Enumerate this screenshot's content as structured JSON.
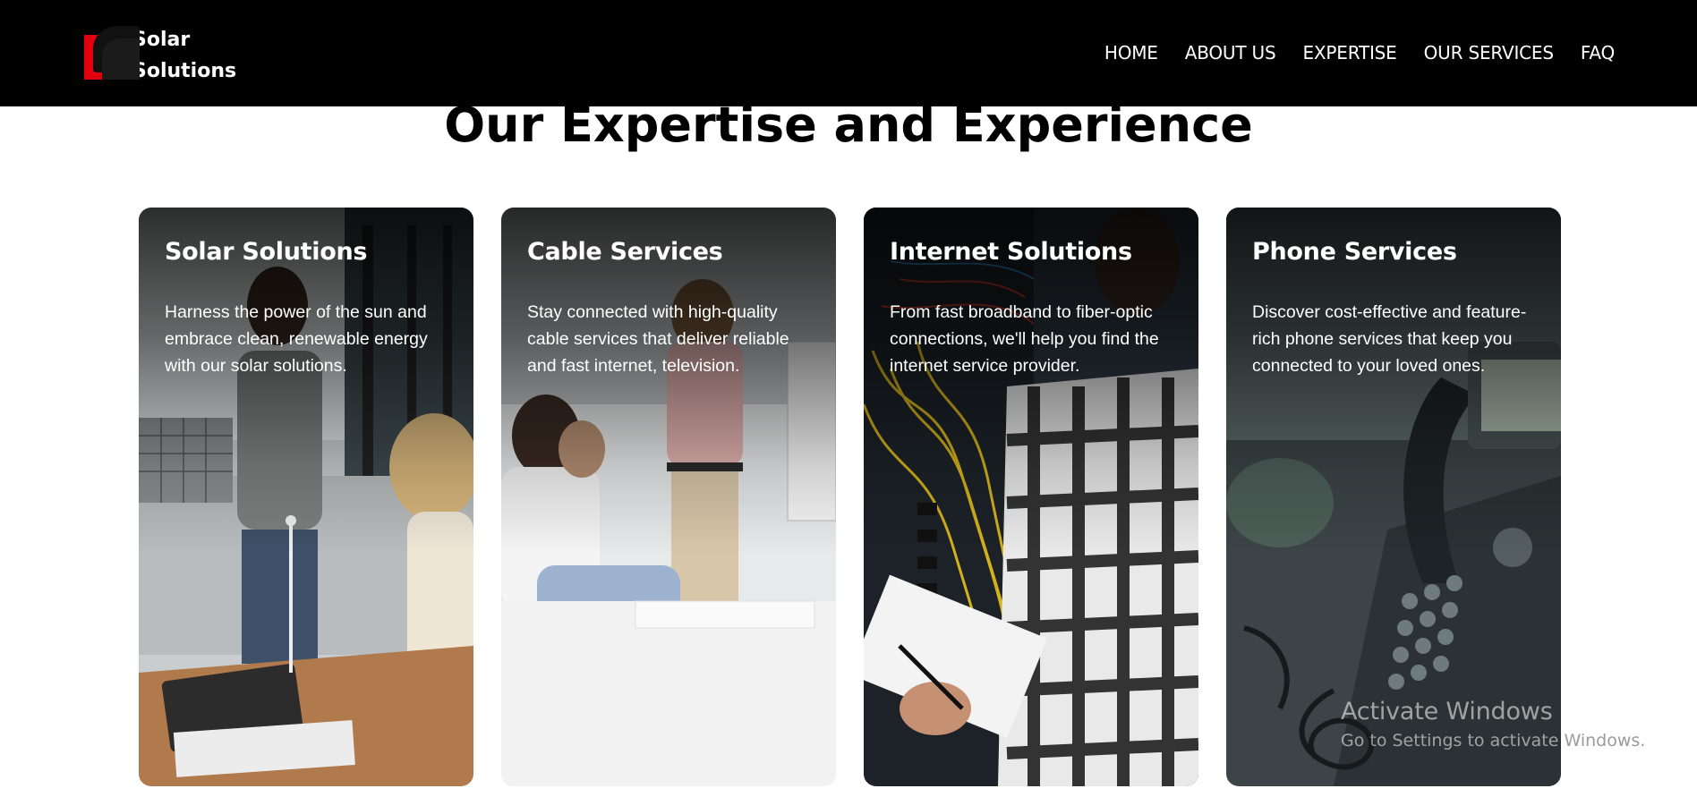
{
  "brand": {
    "line1": "Solar",
    "line2": "Solutions"
  },
  "nav": {
    "items": [
      {
        "label": "HOME"
      },
      {
        "label": "ABOUT US"
      },
      {
        "label": "EXPERTISE"
      },
      {
        "label": "OUR SERVICES"
      },
      {
        "label": "FAQ"
      }
    ]
  },
  "main": {
    "title": "Our Expertise and Experience",
    "cards": [
      {
        "title": "Solar Solutions",
        "text": "Harness the power of the sun and embrace clean, renewable energy with our solar solutions."
      },
      {
        "title": "Cable Services",
        "text": "Stay connected with high-quality cable services that deliver reliable and fast internet, television."
      },
      {
        "title": "Internet Solutions",
        "text": "From fast broadband to fiber-optic connections, we'll help you find the internet service provider."
      },
      {
        "title": "Phone Services",
        "text": "Discover cost-effective and feature-rich phone services that keep you connected to your loved ones."
      }
    ]
  },
  "watermark": {
    "title": "Activate Windows",
    "subtitle_part1": "Go to Settings to activate ",
    "subtitle_part2": "Windows."
  },
  "colors": {
    "navbar": "#000000",
    "brand_red": "#e2000f",
    "text_light": "#ffffff",
    "heading": "#000000"
  }
}
